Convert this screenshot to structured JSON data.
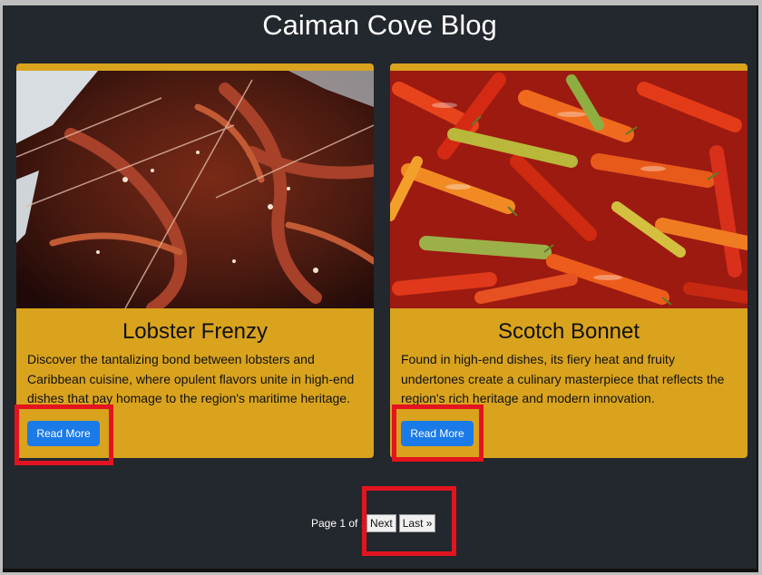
{
  "page": {
    "title": "Caiman Cove Blog"
  },
  "posts": [
    {
      "title": "Lobster Frenzy",
      "excerpt": "Discover the tantalizing bond between lobsters and Caribbean cuisine, where opulent flavors unite in high-end dishes that pay homage to the region's maritime heritage.",
      "button_label": "Read More",
      "image": "lobster-photo"
    },
    {
      "title": "Scotch Bonnet",
      "excerpt": "Found in high-end dishes, its fiery heat and fruity undertones create a culinary masterpiece that reflects the region's rich heritage and modern innovation.",
      "button_label": "Read More",
      "image": "peppers-photo"
    }
  ],
  "pagination": {
    "status": "Page 1 of .",
    "next_label": "Next",
    "last_label": "Last »"
  },
  "colors": {
    "background": "#23272e",
    "card": "#d9a31e",
    "button": "#1a7ae8",
    "highlight": "#e3141f"
  }
}
